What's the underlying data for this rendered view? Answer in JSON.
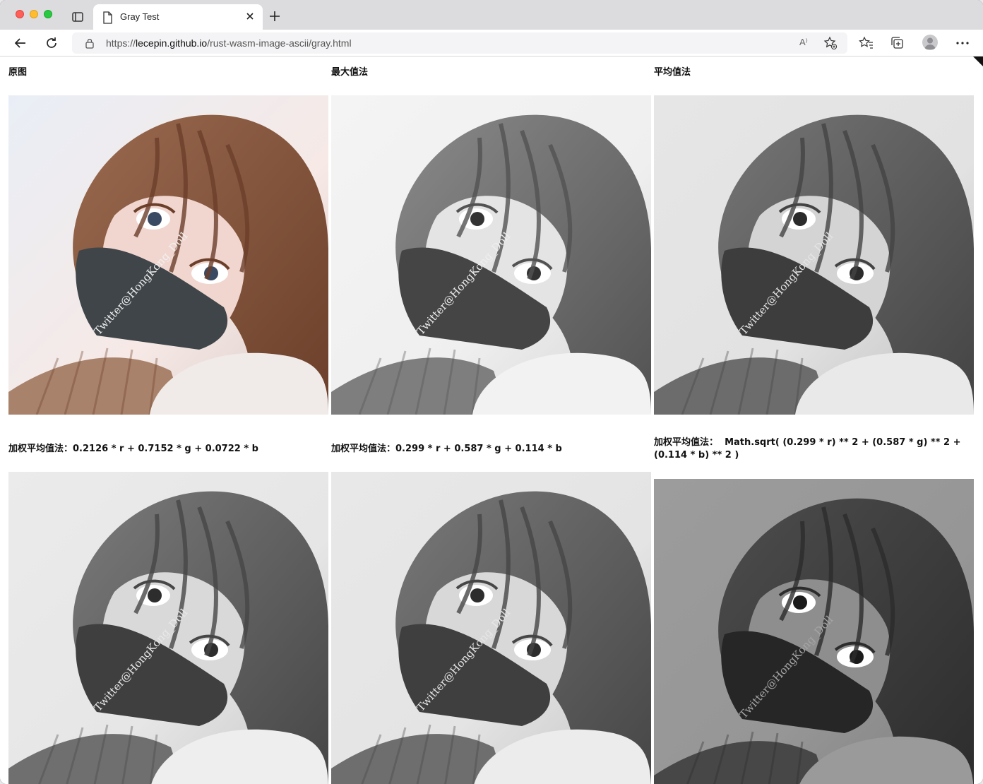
{
  "browser": {
    "tab_title": "Gray Test",
    "url_prefix": "https://",
    "url_host": "lecepin.github.io",
    "url_path": "/rust-wasm-image-ascii/gray.html",
    "read_aloud_glyph": "A⁾"
  },
  "photo": {
    "watermark": "Twitter@HongKong_Doll"
  },
  "panels": [
    {
      "label": "原图",
      "formula": "",
      "mode": "color"
    },
    {
      "label": "最大值法",
      "formula": "",
      "mode": "max"
    },
    {
      "label": "平均值法",
      "formula": "",
      "mode": "avg"
    },
    {
      "label": "加权平均值法：",
      "formula": "0.2126 * r + 0.7152 * g + 0.0722 * b",
      "mode": "w1"
    },
    {
      "label": "加权平均值法：",
      "formula": "0.299 * r + 0.587 * g + 0.114 * b",
      "mode": "w2"
    },
    {
      "label": "加权平均值法：",
      "formula": "Math.sqrt( (0.299 * r) ** 2 + (0.587 * g) ** 2 + (0.114 * b) ** 2 )",
      "mode": "w3"
    }
  ],
  "colors": {
    "tabstrip": "#dcdcde",
    "close_red": "#fe5f57",
    "minimize_yellow": "#febc2e",
    "zoom_green": "#28c840"
  }
}
